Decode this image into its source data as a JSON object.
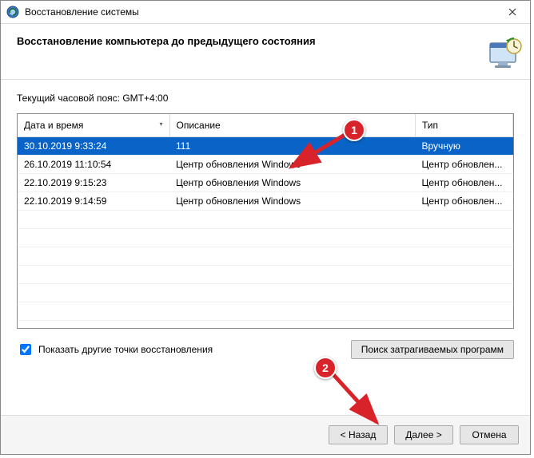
{
  "window": {
    "title": "Восстановление системы"
  },
  "header": {
    "title": "Восстановление компьютера до предыдущего состояния"
  },
  "timezone_label": "Текущий часовой пояс: GMT+4:00",
  "columns": {
    "datetime": "Дата и время",
    "description": "Описание",
    "type": "Тип"
  },
  "rows": [
    {
      "datetime": "30.10.2019 9:33:24",
      "description": "111",
      "type": "Вручную",
      "selected": true
    },
    {
      "datetime": "26.10.2019 11:10:54",
      "description": "Центр обновления Windows",
      "type": "Центр обновлен...",
      "selected": false
    },
    {
      "datetime": "22.10.2019 9:15:23",
      "description": "Центр обновления Windows",
      "type": "Центр обновлен...",
      "selected": false
    },
    {
      "datetime": "22.10.2019 9:14:59",
      "description": "Центр обновления Windows",
      "type": "Центр обновлен...",
      "selected": false
    }
  ],
  "checkbox": {
    "label": "Показать другие точки восстановления",
    "checked": true
  },
  "buttons": {
    "affected": "Поиск затрагиваемых программ",
    "back": "< Назад",
    "next": "Далее >",
    "cancel": "Отмена"
  },
  "annotations": {
    "a1": "1",
    "a2": "2"
  }
}
